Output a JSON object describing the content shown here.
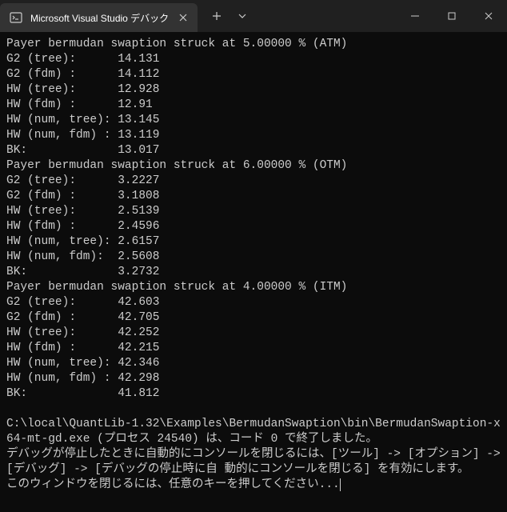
{
  "tab": {
    "title": "Microsoft Visual Studio デバック"
  },
  "output": {
    "block_atm": {
      "header": "Payer bermudan swaption struck at 5.00000 % (ATM)",
      "rows": [
        "G2 (tree):      14.131",
        "G2 (fdm) :      14.112",
        "HW (tree):      12.928",
        "HW (fdm) :      12.91",
        "HW (num, tree): 13.145",
        "HW (num, fdm) : 13.119",
        "BK:             13.017"
      ]
    },
    "block_otm": {
      "header": "Payer bermudan swaption struck at 6.00000 % (OTM)",
      "rows": [
        "G2 (tree):      3.2227",
        "G2 (fdm) :      3.1808",
        "HW (tree):      2.5139",
        "HW (fdm) :      2.4596",
        "HW (num, tree): 2.6157",
        "HW (num, fdm):  2.5608",
        "BK:             3.2732"
      ]
    },
    "block_itm": {
      "header": "Payer bermudan swaption struck at 4.00000 % (ITM)",
      "rows": [
        "G2 (tree):      42.603",
        "G2 (fdm) :      42.705",
        "HW (tree):      42.252",
        "HW (fdm) :      42.215",
        "HW (num, tree): 42.346",
        "HW (num, fdm) : 42.298",
        "BK:             41.812"
      ]
    },
    "footer": [
      "",
      "C:\\local\\QuantLib-1.32\\Examples\\BermudanSwaption\\bin\\BermudanSwaption-x64-mt-gd.exe (プロセス 24540) は、コード 0 で終了しました。",
      "デバッグが停止したときに自動的にコンソールを閉じるには、[ツール] -> [オプション] -> [デバッグ] -> [デバッグの停止時に自 動的にコンソールを閉じる] を有効にします。",
      "このウィンドウを閉じるには、任意のキーを押してください..."
    ]
  },
  "chart_data": {
    "type": "table",
    "title": "Bermudan swaption prices by model",
    "series": [
      {
        "name": "5.00000 % (ATM)",
        "values": {
          "G2 (tree)": 14.131,
          "G2 (fdm)": 14.112,
          "HW (tree)": 12.928,
          "HW (fdm)": 12.91,
          "HW (num, tree)": 13.145,
          "HW (num, fdm)": 13.119,
          "BK": 13.017
        }
      },
      {
        "name": "6.00000 % (OTM)",
        "values": {
          "G2 (tree)": 3.2227,
          "G2 (fdm)": 3.1808,
          "HW (tree)": 2.5139,
          "HW (fdm)": 2.4596,
          "HW (num, tree)": 2.6157,
          "HW (num, fdm)": 2.5608,
          "BK": 3.2732
        }
      },
      {
        "name": "4.00000 % (ITM)",
        "values": {
          "G2 (tree)": 42.603,
          "G2 (fdm)": 42.705,
          "HW (tree)": 42.252,
          "HW (fdm)": 42.215,
          "HW (num, tree)": 42.346,
          "HW (num, fdm)": 42.298,
          "BK": 41.812
        }
      }
    ]
  }
}
